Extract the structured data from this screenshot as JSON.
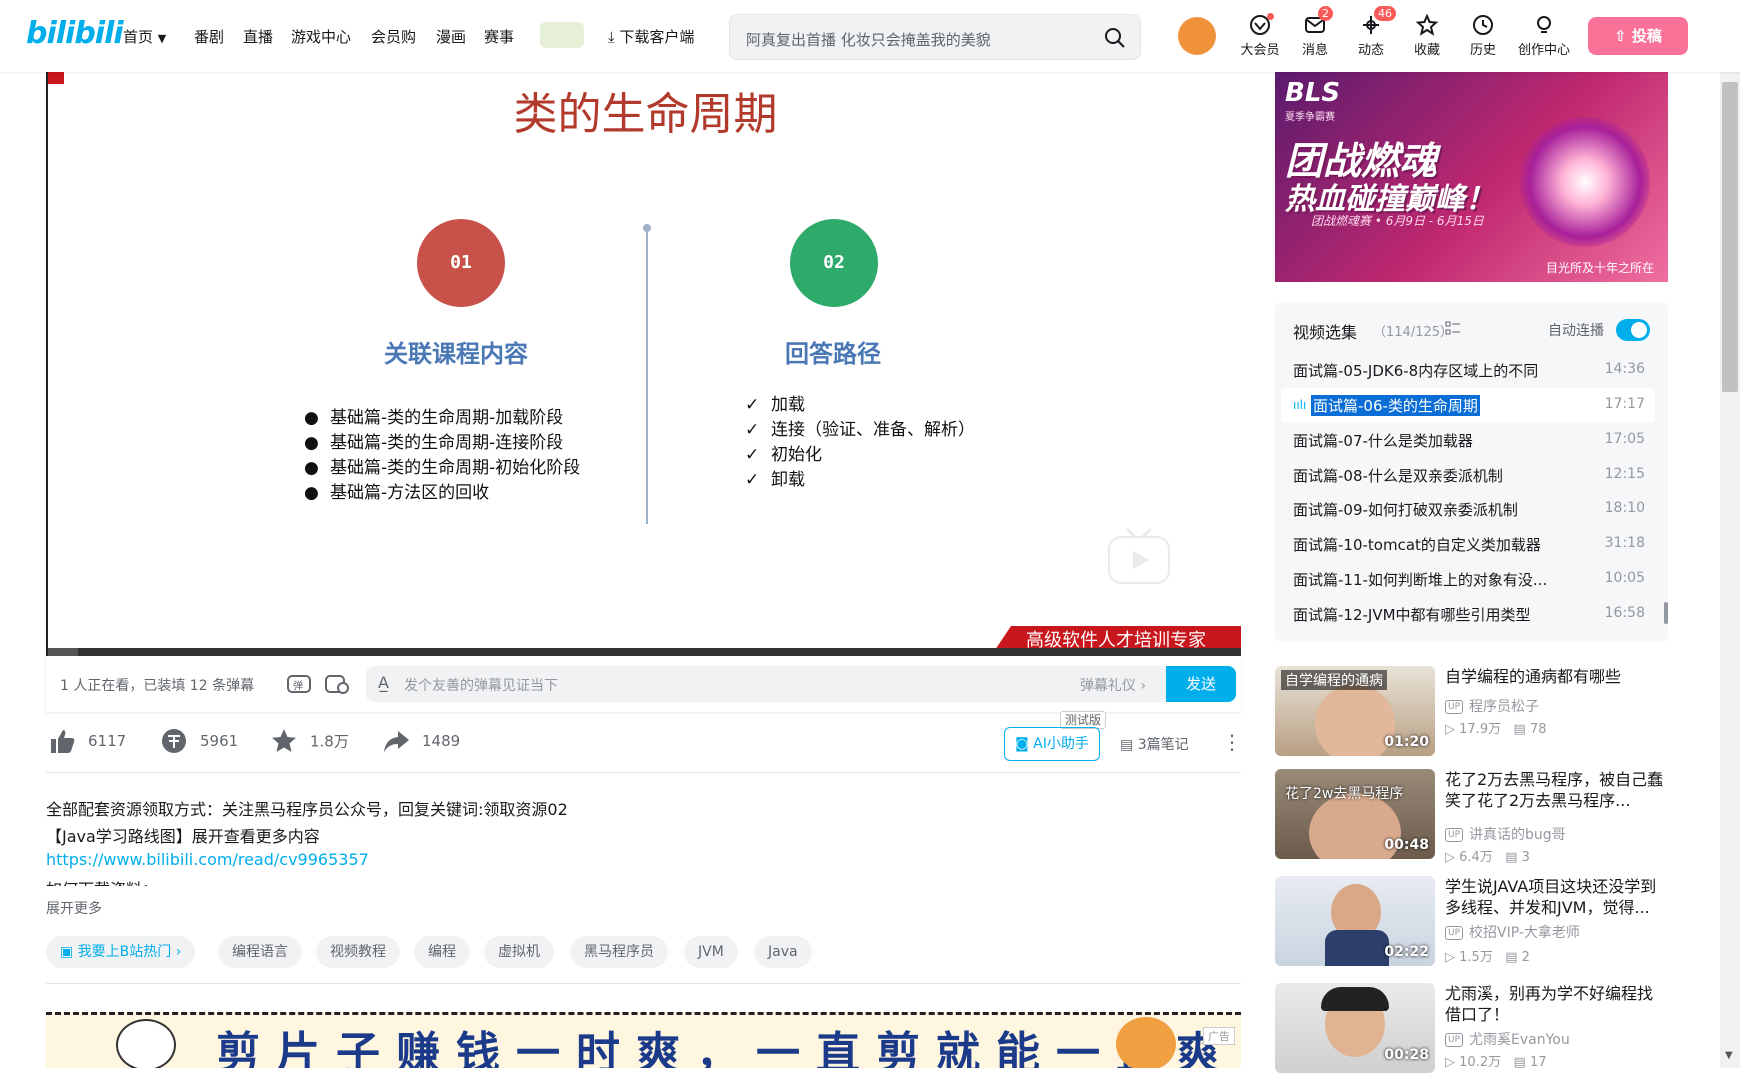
{
  "header": {
    "logo": "bilibili",
    "nav": [
      "首页",
      "番剧",
      "直播",
      "游戏中心",
      "会员购",
      "漫画",
      "赛事"
    ],
    "download": "下载客户端",
    "search_placeholder": "阿真复出首播 化妆只会掩盖我的美貌",
    "icons": [
      {
        "label": "大会员",
        "icon": "vip-icon",
        "badge": ""
      },
      {
        "label": "消息",
        "icon": "message-icon",
        "badge": "2"
      },
      {
        "label": "动态",
        "icon": "dynamic-icon",
        "badge": "46"
      },
      {
        "label": "收藏",
        "icon": "star-icon",
        "badge": ""
      },
      {
        "label": "历史",
        "icon": "clock-icon",
        "badge": ""
      },
      {
        "label": "创作中心",
        "icon": "bulb-icon",
        "badge": ""
      }
    ],
    "upload": "投稿"
  },
  "video": {
    "slide_title": "类的生命周期",
    "col1": {
      "number": "01",
      "heading": "关联课程内容",
      "bullets": [
        "基础篇-类的生命周期-加载阶段",
        "基础篇-类的生命周期-连接阶段",
        "基础篇-类的生命周期-初始化阶段",
        "基础篇-方法区的回收"
      ]
    },
    "col2": {
      "number": "02",
      "heading": "回答路径",
      "checks": [
        "加载",
        "连接（验证、准备、解析）",
        "初始化",
        "卸载"
      ]
    },
    "tagline": "高级软件人才培训专家",
    "progress": 0.025
  },
  "danmaku": {
    "viewers": "1 人正在看，已装填 12 条弹幕",
    "placeholder": "发个友善的弹幕见证当下",
    "etiquette": "弹幕礼仪 ›",
    "send": "发送"
  },
  "actions": {
    "like": "6117",
    "coin": "5961",
    "favorite": "1.8万",
    "share": "1489",
    "ai_assistant": "AI小助手",
    "ai_beta": "测试版",
    "notes": "3篇笔记"
  },
  "description": {
    "line1": "全部配套资源领取方式：关注黑马程序员公众号，回复关键词:领取资源02",
    "line2": "【Java学习路线图】展开查看更多内容",
    "link": "https://www.bilibili.com/read/cv9965357",
    "line4": "如何下载资料：",
    "expand": "展开更多"
  },
  "tags": [
    "我要上B站热门 ›",
    "编程语言",
    "视频教程",
    "编程",
    "虚拟机",
    "黑马程序员",
    "JVM",
    "Java"
  ],
  "banner": {
    "text": "剪片子赚钱一时爽，一直剪就能一直爽",
    "label": "广告"
  },
  "ad_top": {
    "brand": "BLS",
    "sub": "夏季争霸赛",
    "title1": "团战燃魂",
    "title2": "热血碰撞巅峰！",
    "date": "团战燃魂赛 • 6月9日 - 6月15日",
    "footer": "目光所及十年之所在"
  },
  "playlist": {
    "title": "视频选集",
    "count": "（114/125）",
    "autoplay": "自动连播",
    "items": [
      {
        "title": "面试篇-05-JDK6-8内存区域上的不同",
        "duration": "14:36"
      },
      {
        "title": "面试篇-06-类的生命周期",
        "duration": "17:17"
      },
      {
        "title": "面试篇-07-什么是类加载器",
        "duration": "17:05"
      },
      {
        "title": "面试篇-08-什么是双亲委派机制",
        "duration": "12:15"
      },
      {
        "title": "面试篇-09-如何打破双亲委派机制",
        "duration": "18:10"
      },
      {
        "title": "面试篇-10-tomcat的自定义类加载器",
        "duration": "31:18"
      },
      {
        "title": "面试篇-11-如何判断堆上的对象有没...",
        "duration": "10:05"
      },
      {
        "title": "面试篇-12-JVM中都有哪些引用类型",
        "duration": "16:58"
      }
    ]
  },
  "recommendations": [
    {
      "title": "自学编程的通病都有哪些",
      "up": "程序员松子",
      "views": "17.9万",
      "comments": "78",
      "duration": "01:20",
      "caption": "自学编程的通病"
    },
    {
      "title": "花了2万去黑马程序，被自己蠢笑了花了2万去黑马程序...",
      "up": "讲真话的bug哥",
      "views": "6.4万",
      "comments": "3",
      "duration": "00:48",
      "caption": "花了2w去黑马程序"
    },
    {
      "title": "学生说JAVA项目这块还没学到多线程、并发和JVM，觉得...",
      "up": "校招VIP-大拿老师",
      "views": "1.5万",
      "comments": "2",
      "duration": "02:22",
      "caption": ""
    },
    {
      "title": "尤雨溪，别再为学不好编程找借口了！",
      "up": "尤雨奚EvanYou",
      "views": "10.2万",
      "comments": "17",
      "duration": "00:28",
      "caption": ""
    }
  ]
}
